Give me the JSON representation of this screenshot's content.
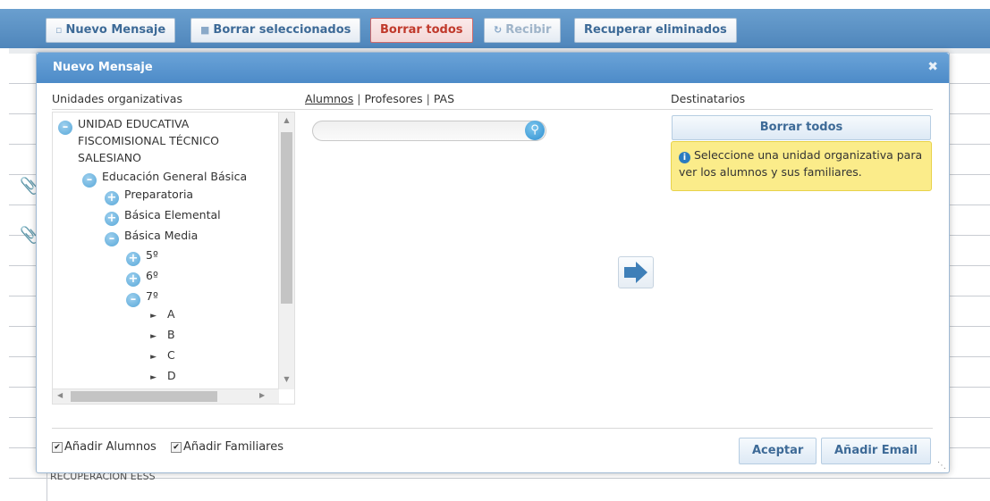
{
  "background": {
    "bottom_text": "RECUPERACIÓN EESS"
  },
  "toolbar": {
    "new_message": "Nuevo Mensaje",
    "delete_selected": "Borrar seleccionados",
    "delete_all": "Borrar todos",
    "receive": "Recibir",
    "recover_deleted": "Recuperar eliminados"
  },
  "dialog": {
    "title": "Nuevo Mensaje",
    "org_units_header": "Unidades organizativas",
    "tabs": [
      {
        "label": "Alumnos"
      },
      {
        "label": "Profesores"
      },
      {
        "label": "PAS"
      }
    ],
    "tab_separator": "|",
    "recipients_header": "Destinatarios",
    "tree": [
      {
        "label": "UNIDAD EDUCATIVA",
        "type": "minus"
      },
      {
        "label": "FISCOMISIONAL TÉCNICO",
        "type": "cont"
      },
      {
        "label": "SALESIANO",
        "type": "cont"
      },
      {
        "label": "Educación General Básica",
        "type": "minus"
      },
      {
        "label": "Preparatoria",
        "type": "plus"
      },
      {
        "label": "Básica Elemental",
        "type": "plus"
      },
      {
        "label": "Básica Media",
        "type": "minus"
      },
      {
        "label": "5º",
        "type": "plus"
      },
      {
        "label": "6º",
        "type": "plus"
      },
      {
        "label": "7º",
        "type": "minus"
      },
      {
        "label": "A",
        "type": "leaf"
      },
      {
        "label": "B",
        "type": "leaf"
      },
      {
        "label": "C",
        "type": "leaf"
      },
      {
        "label": "D",
        "type": "leaf"
      }
    ],
    "search": {
      "placeholder": ""
    },
    "recipients": {
      "clear_all": "Borrar todos",
      "info": "Seleccione una unidad organizativa para ver los alumnos y sus familiares."
    },
    "footer": {
      "add_students": "Añadir Alumnos",
      "add_families": "Añadir Familiares",
      "accept": "Aceptar",
      "add_email": "Añadir Email"
    }
  },
  "colors": {
    "accent": "#4d8bc8",
    "danger": "#c0392b",
    "info_bg": "#fbec8a"
  }
}
